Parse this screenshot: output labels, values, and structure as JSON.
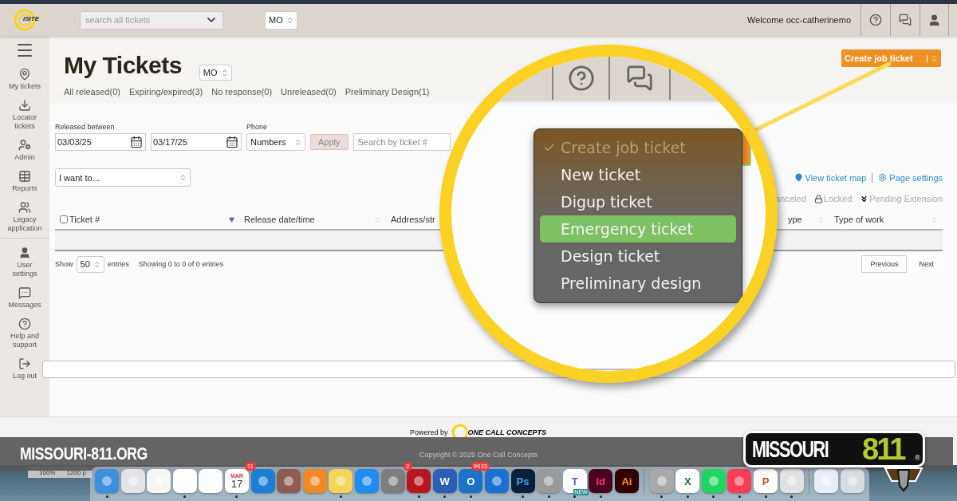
{
  "header": {
    "logo": "iSITE",
    "search": {
      "placeholder": "search all tickets"
    },
    "state": "MO",
    "welcome": "Welcome occ-catherinemo"
  },
  "sidebar": {
    "items": [
      {
        "kind": "pin",
        "label": "My tickets"
      },
      {
        "kind": "download",
        "label": "Locator tickets"
      },
      {
        "kind": "admin",
        "label": "Admin"
      },
      {
        "kind": "grid",
        "label": "Reports"
      },
      {
        "kind": "users",
        "label": "Legacy application"
      },
      {
        "kind": "user",
        "label": "User settings"
      },
      {
        "kind": "message",
        "label": "Messages"
      },
      {
        "kind": "help",
        "label": "Help and support"
      },
      {
        "kind": "logout",
        "label": "Log out"
      }
    ]
  },
  "page": {
    "title": "My Tickets",
    "state": "MO",
    "filters": [
      "All released(0)",
      "Expiring/expired(3)",
      "No response(0)",
      "Unreleased(0)",
      "Preliminary Design(1)"
    ],
    "create_button": "Create job ticket",
    "form": {
      "released_label": "Released between",
      "from": "03/03/25",
      "to": "03/17/25",
      "phone_label": "Phone",
      "phone": "Numbers",
      "apply": "Apply",
      "search_placeholder": "Search by ticket #"
    },
    "action_select": "I want to...",
    "links": [
      {
        "kind": "map",
        "label": "View ticket map"
      },
      {
        "kind": "settings",
        "label": "Page settings"
      }
    ],
    "legend": [
      {
        "kind": "plain",
        "label": "anceled"
      },
      {
        "kind": "lock",
        "label": "Locked"
      },
      {
        "kind": "chevrons",
        "label": "Pending Extension"
      }
    ],
    "table": {
      "select_all_checked": false,
      "columns": [
        {
          "label": "Ticket #",
          "sorted": true
        },
        {
          "label": "Release date/time",
          "sorted": false
        },
        {
          "label": "Address/str"
        },
        {
          "label": "ype",
          "sorted": false
        },
        {
          "label": "Type of work",
          "sorted": false
        }
      ]
    },
    "length_before": "Show",
    "length": "50",
    "length_after": "entries",
    "info": "Showing 0 to 0 of 0 entries",
    "pager": [
      "Previous",
      "Next"
    ]
  },
  "magnifier": {
    "menu": [
      {
        "label": "Create job ticket",
        "checked": true,
        "highlighted": false,
        "disabled": true
      },
      {
        "label": "New ticket",
        "checked": false,
        "highlighted": false,
        "disabled": false
      },
      {
        "label": "Digup ticket",
        "checked": false,
        "highlighted": false,
        "disabled": false
      },
      {
        "label": "Emergency ticket",
        "checked": false,
        "highlighted": true,
        "disabled": false
      },
      {
        "label": "Design ticket",
        "checked": false,
        "highlighted": false,
        "disabled": false
      },
      {
        "label": "Preliminary design",
        "checked": false,
        "highlighted": false,
        "disabled": false
      }
    ]
  },
  "footer": {
    "powered_by": "Powered by",
    "brand": "ONE CALL CONCEPTS",
    "copyright": "Copyright © 2025 One Call Concepts"
  },
  "banner": {
    "url": "MISSOURI-811.ORG"
  },
  "logo_811": {
    "word": "MISSOURI",
    "number": "811",
    "mark": "®"
  },
  "desktop": {
    "zoom": "100%",
    "size": "1200 p"
  },
  "dock": [
    {
      "kind": "app",
      "color": "#3d8fe0",
      "running": true
    },
    {
      "kind": "app",
      "color": "#e4e4e8",
      "running": false
    },
    {
      "kind": "app",
      "color": "#f6f6f2",
      "running": false
    },
    {
      "kind": "app",
      "color": "#ffffff",
      "running": true
    },
    {
      "kind": "app",
      "color": "#fdfdfd",
      "running": false
    },
    {
      "kind": "calendar",
      "color": "#ffffff",
      "month": "MAR",
      "glyph": "17",
      "badge": "11",
      "running": true
    },
    {
      "kind": "app",
      "color": "#1c7fd6",
      "running": false
    },
    {
      "kind": "app",
      "color": "#8e5c52",
      "running": false
    },
    {
      "kind": "app",
      "color": "#f08a24",
      "running": false
    },
    {
      "kind": "app",
      "color": "#f6d458",
      "running": true
    },
    {
      "kind": "app",
      "color": "#1e8cf0",
      "running": false
    },
    {
      "kind": "app",
      "color": "#7d7d7d",
      "badge": "2",
      "running": false
    },
    {
      "kind": "app",
      "color": "#b8161c",
      "running": true
    },
    {
      "kind": "app",
      "color": "#2b5fb5",
      "glyph": {
        "text": "W",
        "color": "#ffffff"
      },
      "running": true
    },
    {
      "kind": "app",
      "color": "#1a73c9",
      "glyph": {
        "text": "O",
        "color": "#ffffff"
      },
      "badge": "9933",
      "running": true
    },
    {
      "kind": "app",
      "color": "#1d6fd1",
      "running": false
    },
    {
      "kind": "app",
      "color": "#0b1f3a",
      "glyph": {
        "text": "Ps",
        "color": "#31a8ff"
      },
      "running": true
    },
    {
      "kind": "app",
      "color": "#9a9a9a",
      "running": true
    },
    {
      "kind": "teams",
      "color": "#ffffff",
      "glyph": {
        "text": "T",
        "color": "#5b5fc7"
      },
      "tag": "NEW",
      "running": true
    },
    {
      "kind": "app",
      "color": "#49021f",
      "glyph": {
        "text": "Id",
        "color": "#ff3366"
      },
      "running": true
    },
    {
      "kind": "app",
      "color": "#330000",
      "glyph": {
        "text": "Ai",
        "color": "#ff9a00"
      },
      "running": false
    },
    {
      "kind": "separator"
    },
    {
      "kind": "app",
      "color": "#a9a9a9",
      "running": true
    },
    {
      "kind": "app",
      "color": "#ffffff",
      "glyph": {
        "text": "X",
        "color": "#1d7044"
      },
      "running": true
    },
    {
      "kind": "app",
      "color": "#1ed760",
      "running": true
    },
    {
      "kind": "app",
      "color": "#fa3d55",
      "running": true
    },
    {
      "kind": "app",
      "color": "#ffffff",
      "glyph": {
        "text": "P",
        "color": "#d24726"
      },
      "running": true
    },
    {
      "kind": "app",
      "color": "#e2e2e2",
      "running": true
    },
    {
      "kind": "separator"
    },
    {
      "kind": "app",
      "color": "#e9eef6",
      "running": false
    },
    {
      "kind": "app",
      "color": "#d8dde2",
      "running": false
    }
  ]
}
